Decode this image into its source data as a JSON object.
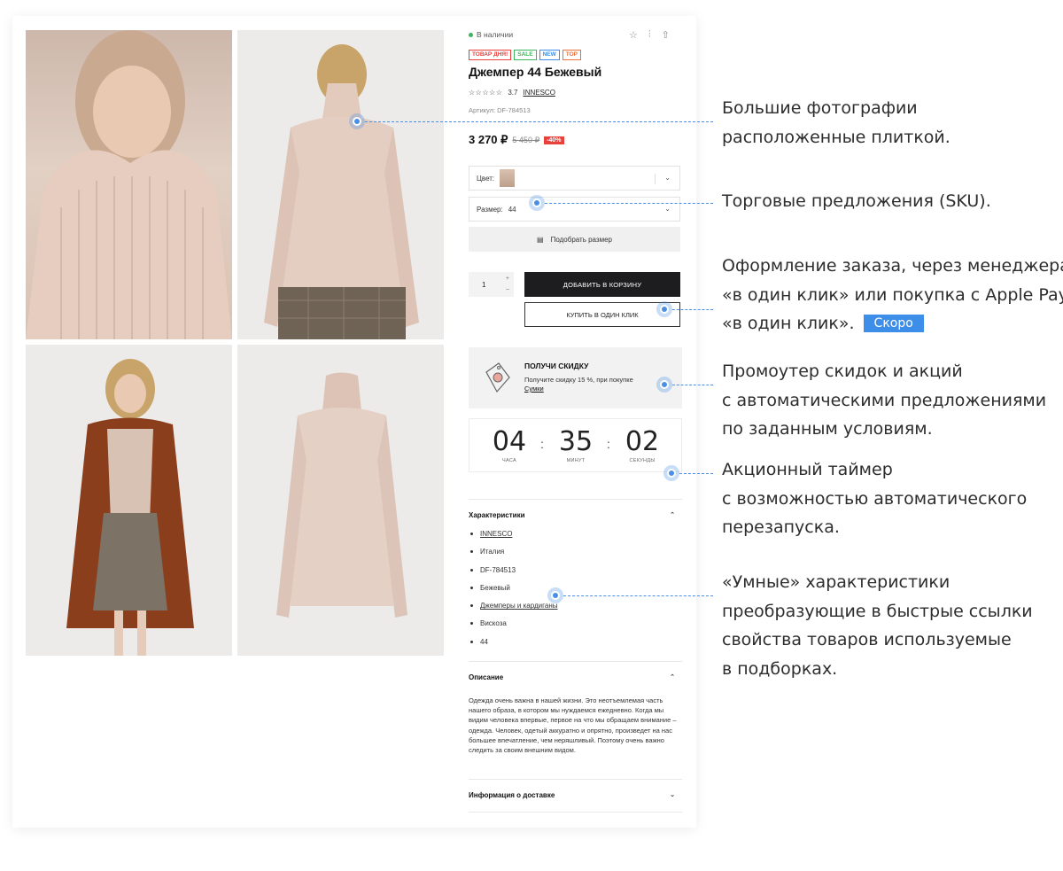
{
  "product": {
    "stock": "В наличии",
    "badges": [
      {
        "label": "ТОВАР ДНЯ!",
        "color": "#e8413c"
      },
      {
        "label": "SALE",
        "color": "#3cb55e"
      },
      {
        "label": "NEW",
        "color": "#3d8ee8"
      },
      {
        "label": "TOP",
        "color": "#e8713c"
      }
    ],
    "title": "Джемпер 44 Бежевый",
    "stars": "☆☆☆☆☆",
    "rating": "3.7",
    "brand": "INNESCO",
    "article": "Артикул: DF-784513",
    "price": "3 270 ₽",
    "old_price": "5 450 ₽",
    "discount": "-40%"
  },
  "options": {
    "color_label": "Цвет:",
    "size_label": "Размер:",
    "size_value": "44",
    "size_picker": "Подобрать размер"
  },
  "cart": {
    "quantity": "1",
    "plus": "+",
    "minus": "–",
    "add_to_cart": "ДОБАВИТЬ В КОРЗИНУ",
    "one_click": "КУПИТЬ В ОДИН КЛИК"
  },
  "promo": {
    "title": "ПОЛУЧИ СКИДКУ",
    "text": "Получите скидку 15 %, при покупке",
    "link": "Сумки"
  },
  "timer": {
    "hours": "04",
    "hours_label": "ЧАСА",
    "minutes": "35",
    "minutes_label": "МИНУТ",
    "seconds": "02",
    "seconds_label": "СЕКУНДЫ"
  },
  "characteristics": {
    "title": "Характеристики",
    "items": [
      {
        "text": "INNESCO",
        "link": true
      },
      {
        "text": "Италия",
        "link": false
      },
      {
        "text": "DF-784513",
        "link": false
      },
      {
        "text": "Бежевый",
        "link": false
      },
      {
        "text": "Джемперы и кардиганы",
        "link": true
      },
      {
        "text": "Вискоза",
        "link": false
      },
      {
        "text": "44",
        "link": false
      }
    ]
  },
  "description": {
    "title": "Описание",
    "text": "Одежда очень важна в нашей жизни. Это неотъемлемая часть нашего образа, в котором мы нуждаемся ежедневно. Когда мы видим человека впервые, первое на что мы обращаем внимание – одежда. Человек, одетый аккуратно и опрятно, произведет на нас большее впечатление, чем неряшливый. Поэтому очень важно следить за своим внешним видом."
  },
  "delivery": {
    "title": "Информация о доставке"
  },
  "annotations": {
    "photos": [
      "Большие фотографии",
      "расположенные плиткой."
    ],
    "sku": [
      "Торговые предложения (SKU)."
    ],
    "checkout": [
      "Оформление заказа, через менеджера",
      "«в один клик» или покупка с Apple Pay",
      "«в один клик»."
    ],
    "soon": "Скоро",
    "promo": [
      "Промоутер скидок и акций",
      "с автоматическими предложениями",
      "по заданным условиям."
    ],
    "timer": [
      "Акционный таймер",
      "с возможностью автоматического",
      "перезапуска."
    ],
    "smart": [
      "«Умные» характеристики",
      "преобразующие в быстрые ссылки",
      "свойства товаров используемые",
      "в подборках."
    ]
  }
}
